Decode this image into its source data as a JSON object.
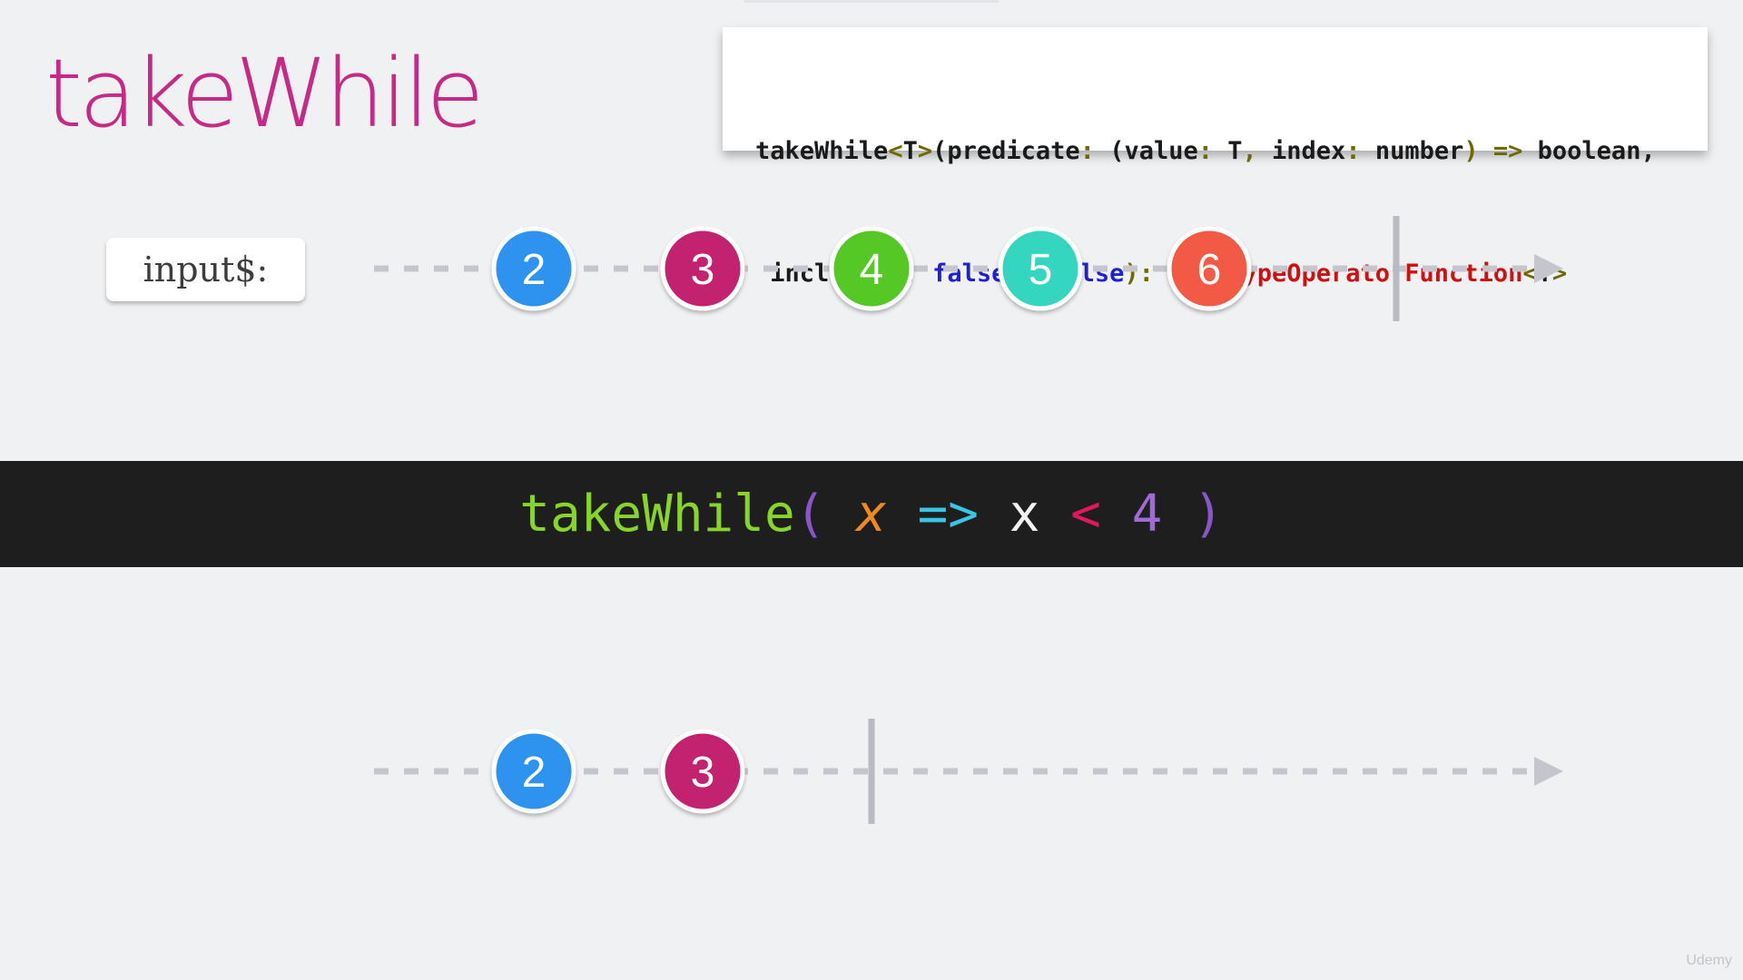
{
  "title": "takeWhile",
  "signature": {
    "line1": [
      {
        "t": "takeWhile",
        "c": ""
      },
      {
        "t": "<",
        "c": "c-punct"
      },
      {
        "t": "T",
        "c": ""
      },
      {
        "t": ">",
        "c": "c-punct"
      },
      {
        "t": "(predicate",
        "c": ""
      },
      {
        "t": ": ",
        "c": "c-punct"
      },
      {
        "t": "(value",
        "c": ""
      },
      {
        "t": ": ",
        "c": "c-punct"
      },
      {
        "t": "T",
        "c": ""
      },
      {
        "t": ", ",
        "c": "c-punct"
      },
      {
        "t": "index",
        "c": ""
      },
      {
        "t": ": ",
        "c": "c-punct"
      },
      {
        "t": "number",
        "c": ""
      },
      {
        "t": ") => ",
        "c": "c-punct"
      },
      {
        "t": "boolean,",
        "c": ""
      }
    ],
    "line2": [
      {
        "t": " inclusive",
        "c": ""
      },
      {
        "t": ": ",
        "c": "c-punct"
      },
      {
        "t": "false",
        "c": "c-kw"
      },
      {
        "t": " = ",
        "c": "c-punct"
      },
      {
        "t": "false",
        "c": "c-kw"
      },
      {
        "t": "): ",
        "c": "c-punct"
      },
      {
        "t": "MonoTypeOperatorFunction",
        "c": "c-type"
      },
      {
        "t": "<",
        "c": "c-punct"
      },
      {
        "t": "T",
        "c": ""
      },
      {
        "t": ">",
        "c": "c-punct"
      }
    ]
  },
  "input_label": "input$:",
  "operator": {
    "name": "takeWhile",
    "open_paren": "(",
    "param": "x",
    "arrow": "=>",
    "var": "x",
    "op": "<",
    "num": "4",
    "close_paren": ")"
  },
  "input_stream": {
    "marbles": [
      {
        "label": "2",
        "color": "#2d93ee"
      },
      {
        "label": "3",
        "color": "#c2226f"
      },
      {
        "label": "4",
        "color": "#55c827"
      },
      {
        "label": "5",
        "color": "#36d6c0"
      },
      {
        "label": "6",
        "color": "#f25a45"
      }
    ],
    "completes": true
  },
  "output_stream": {
    "marbles": [
      {
        "label": "2",
        "color": "#2d93ee"
      },
      {
        "label": "3",
        "color": "#c2226f"
      }
    ],
    "completes": true
  },
  "watermark": "Udemy"
}
